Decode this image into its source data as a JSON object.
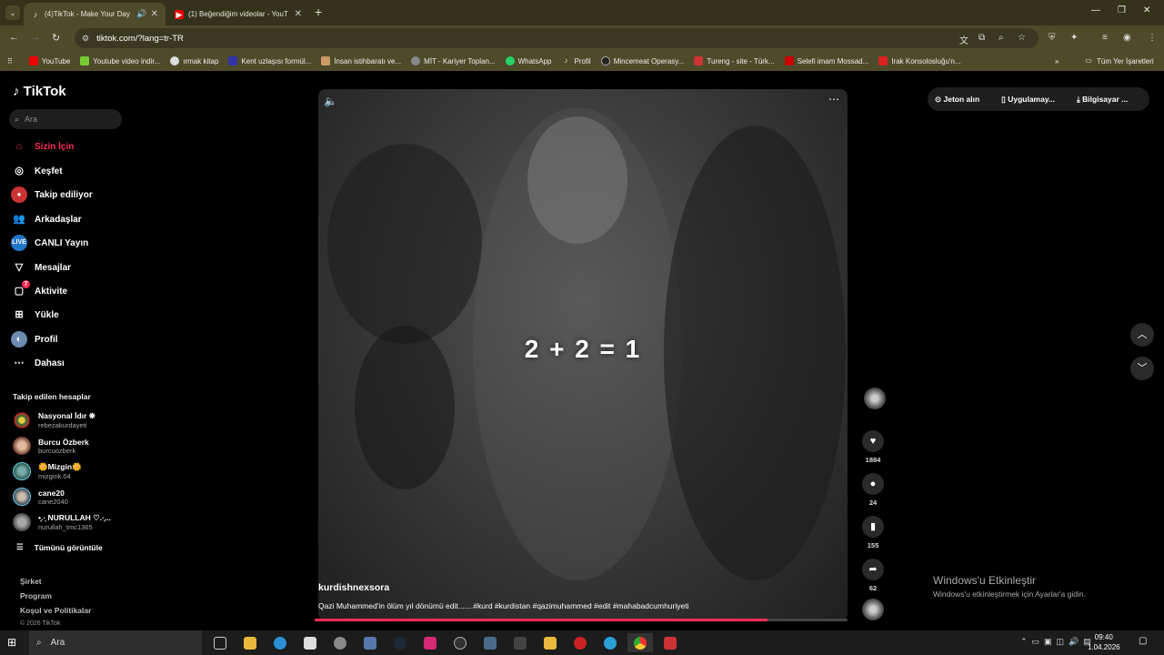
{
  "browser": {
    "tabs": [
      {
        "title": "(4)TikTok - Make Your Day",
        "active": true
      },
      {
        "title": "(1) Beğendiğim videolar - YouT",
        "active": false
      }
    ],
    "url": "tiktok.com/?lang=tr-TR",
    "bookmarks": [
      "YouTube",
      "Youtube video indir...",
      "ırmak kitap",
      "Kent uzlaşısı formül...",
      "İnsan istihbaratı ve...",
      "MİT - Kariyer Toplan...",
      "WhatsApp",
      "Profil",
      "Mincemeat Operasy...",
      "Tureng - site - Türk...",
      "Selefi imam Mossad...",
      "Irak Konsolosluğu'n..."
    ],
    "all_bookmarks": "Tüm Yer İşaretleri"
  },
  "sidebar": {
    "logo": "TikTok",
    "search_placeholder": "Ara",
    "nav": [
      {
        "label": "Sizin İçin",
        "icon": "home-icon"
      },
      {
        "label": "Keşfet",
        "icon": "compass-icon"
      },
      {
        "label": "Takip ediliyor",
        "icon": "following-icon"
      },
      {
        "label": "Arkadaşlar",
        "icon": "friends-icon"
      },
      {
        "label": "CANLI Yayın",
        "icon": "live-icon"
      },
      {
        "label": "Mesajlar",
        "icon": "messages-icon"
      },
      {
        "label": "Aktivite",
        "icon": "activity-icon",
        "badge": "7"
      },
      {
        "label": "Yükle",
        "icon": "upload-icon"
      },
      {
        "label": "Profil",
        "icon": "profile-icon"
      },
      {
        "label": "Dahası",
        "icon": "more-icon"
      }
    ],
    "following_title": "Takip edilen hesaplar",
    "following": [
      {
        "name": "Nasyonal İdır ❋",
        "handle": "rebezakurdayeti"
      },
      {
        "name": "Burcu Özberk",
        "handle": "burcuozberk"
      },
      {
        "name": "🌼Mizgin🌼",
        "handle": "mizgink.04"
      },
      {
        "name": "cane20",
        "handle": "cane2040"
      },
      {
        "name": "•̩̩̩̩̩̩.·̩͙ NURULLAH ♡.·̩͙...",
        "handle": "nurullah_tmc1365"
      }
    ],
    "see_all": "Tümünü görüntüle",
    "footer": [
      "Şirket",
      "Program",
      "Koşul ve Politikalar"
    ],
    "copyright": "© 2026 TikTok"
  },
  "video": {
    "overlay_text": "2 + 2 = 1",
    "author": "kurdishnexsora",
    "caption": "Qazi Muhammed'in ölüm yıl dönümü edit.......#kurd #kurdistan #qazimuhammed #edit #mahabadcumhuriyeti",
    "progress": 0.85,
    "likes": "1884",
    "comments": "24",
    "saves": "155",
    "shares": "62"
  },
  "top_actions": {
    "coins": "Jeton alın",
    "app": "Uygulamay...",
    "computer": "Bilgisayar ..."
  },
  "windows": {
    "activate_title": "Windows'u Etkinleştir",
    "activate_sub": "Windows'u etkinleştirmek için Ayarlar'a gidin.",
    "search": "Ara",
    "time": "09:40",
    "date": "1.04.2026"
  }
}
